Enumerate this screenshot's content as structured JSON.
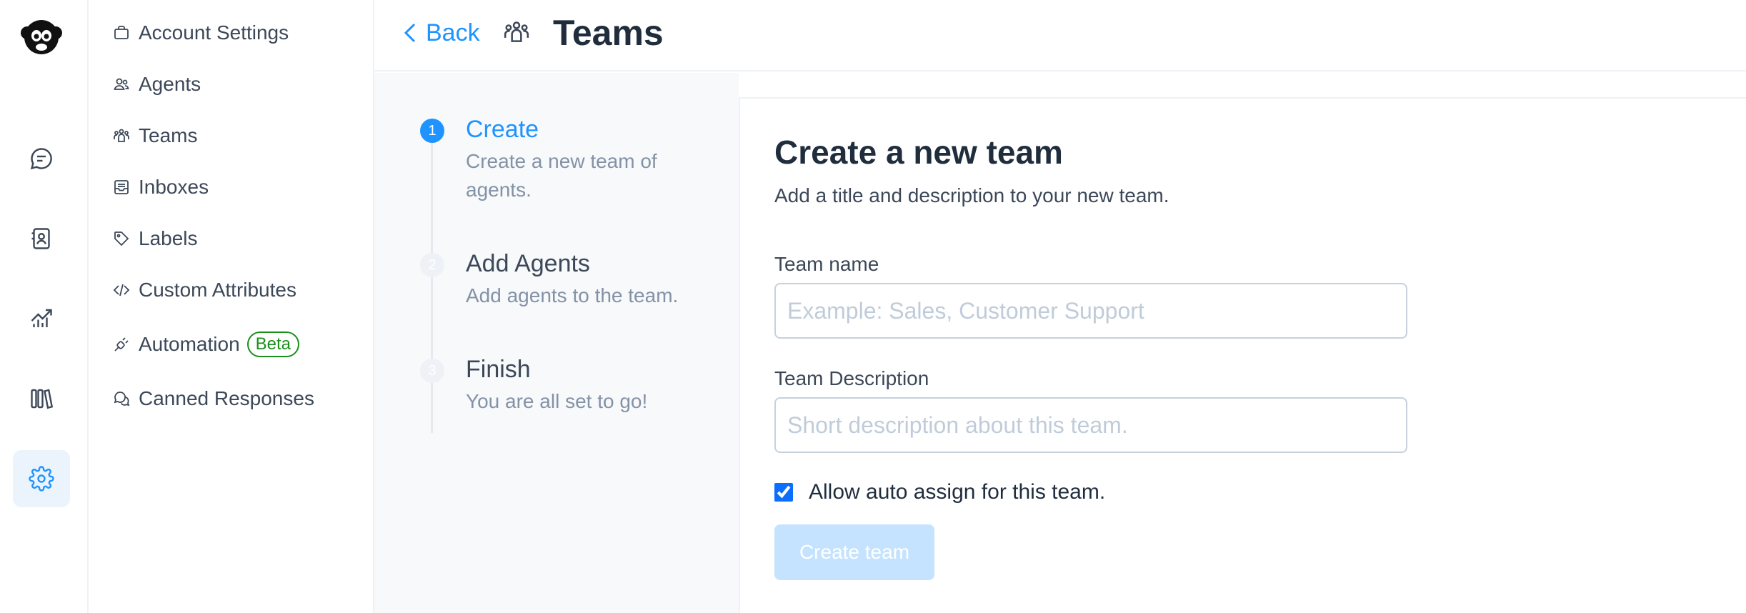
{
  "rail": {
    "items": [
      {
        "name": "conversations",
        "icon": "chat-bubble-icon"
      },
      {
        "name": "contacts",
        "icon": "contact-book-icon"
      },
      {
        "name": "reports",
        "icon": "chart-line-icon"
      },
      {
        "name": "campaigns",
        "icon": "library-icon"
      },
      {
        "name": "settings",
        "icon": "gear-icon",
        "active": true
      }
    ]
  },
  "sidebar": {
    "items": [
      {
        "label": "Account Settings",
        "icon": "briefcase-icon"
      },
      {
        "label": "Agents",
        "icon": "people-icon"
      },
      {
        "label": "Teams",
        "icon": "team-icon"
      },
      {
        "label": "Inboxes",
        "icon": "inbox-icon"
      },
      {
        "label": "Labels",
        "icon": "tag-icon"
      },
      {
        "label": "Custom Attributes",
        "icon": "code-icon"
      },
      {
        "label": "Automation",
        "icon": "automation-icon",
        "badge": "Beta"
      },
      {
        "label": "Canned Responses",
        "icon": "chat-multiple-icon"
      }
    ]
  },
  "header": {
    "back_label": "Back",
    "title": "Teams"
  },
  "steps": [
    {
      "number": "1",
      "title": "Create",
      "description": "Create a new team of agents.",
      "active": true
    },
    {
      "number": "2",
      "title": "Add Agents",
      "description": "Add agents to the team.",
      "active": false
    },
    {
      "number": "3",
      "title": "Finish",
      "description": "You are all set to go!",
      "active": false
    }
  ],
  "form": {
    "title": "Create a new team",
    "subtitle": "Add a title and description to your new team.",
    "team_name_label": "Team name",
    "team_name_value": "",
    "team_name_placeholder": "Example: Sales, Customer Support",
    "team_description_label": "Team Description",
    "team_description_value": "",
    "team_description_placeholder": "Short description about this team.",
    "auto_assign_label": "Allow auto assign for this team.",
    "auto_assign_checked": true,
    "submit_label": "Create team"
  },
  "colors": {
    "accent": "#1f93ff",
    "submit_disabled_bg": "#c5e3fe",
    "beta_green": "#1a8f1a"
  }
}
